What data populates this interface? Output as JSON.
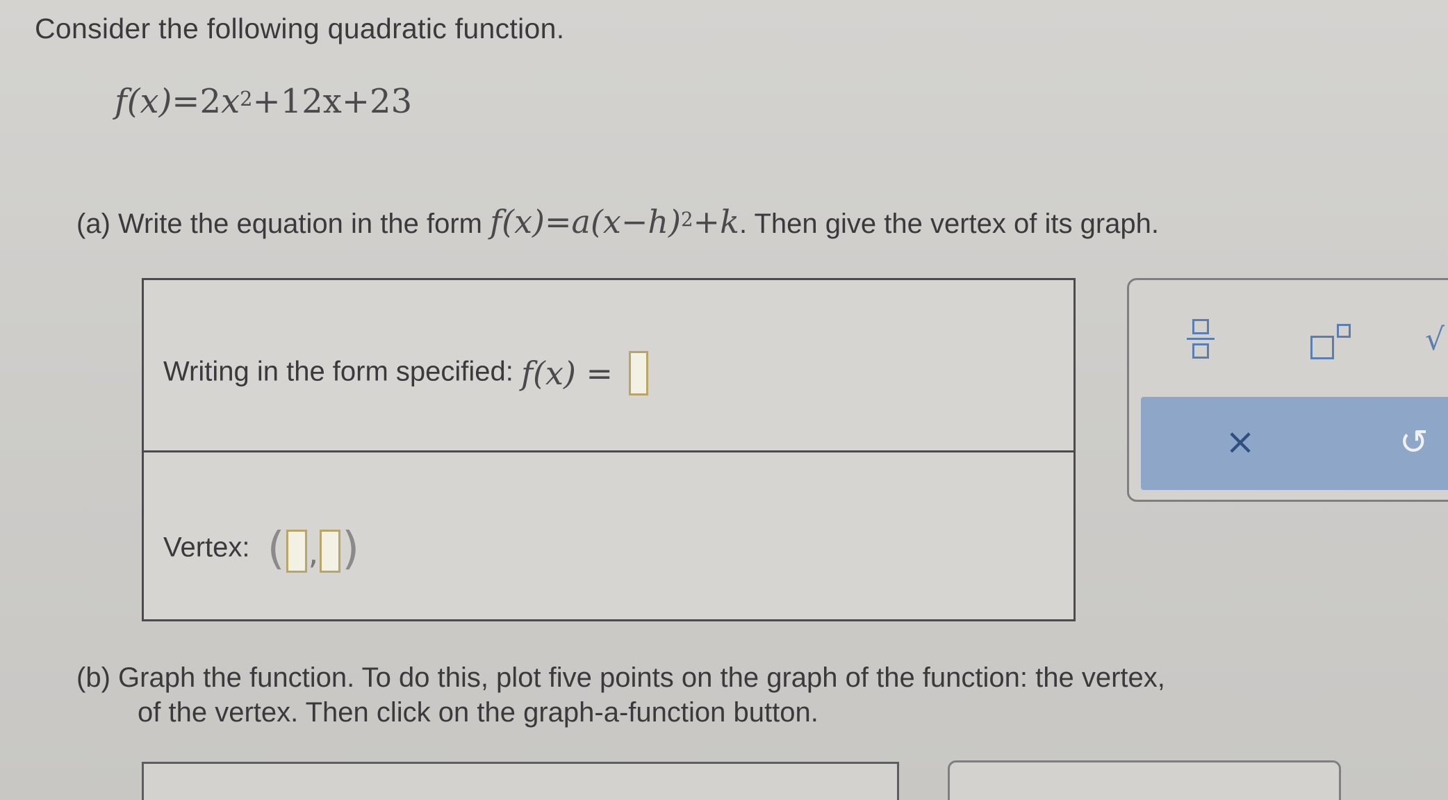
{
  "intro": "Consider the following quadratic function.",
  "function": {
    "lhs": "f(x)",
    "eq": "=",
    "coef_a": "2",
    "var": "x",
    "exp": "2",
    "rest": "+12x+23"
  },
  "part_a": {
    "label": "(a)",
    "prefix": "Write the equation in the form",
    "form_lhs": "f(x)",
    "form_rhs_a": "=a(x−h)",
    "form_exp": "2",
    "form_rhs_k": "+k",
    "suffix": ". Then give the vertex of its graph."
  },
  "answer": {
    "row1_label": "Writing in the form specified:",
    "row1_lhs": "f(x) =",
    "row2_label": "Vertex:",
    "open_paren": "(",
    "comma": ",",
    "close_paren": ")"
  },
  "toolbar": {
    "sqrt_glyph": "√",
    "clear_glyph": "×",
    "undo_glyph": "↺",
    "accent_color": "#5a7eaf",
    "strip_color": "#8ea6c8"
  },
  "part_b": {
    "label": "(b)",
    "line1": "Graph the function. To do this, plot five points on the graph of the function: the vertex,",
    "line2": "of the vertex. Then click on the graph-a-function button."
  },
  "icons": [
    "fraction-icon",
    "superscript-icon",
    "sqrt-icon",
    "clear-icon",
    "undo-icon"
  ]
}
